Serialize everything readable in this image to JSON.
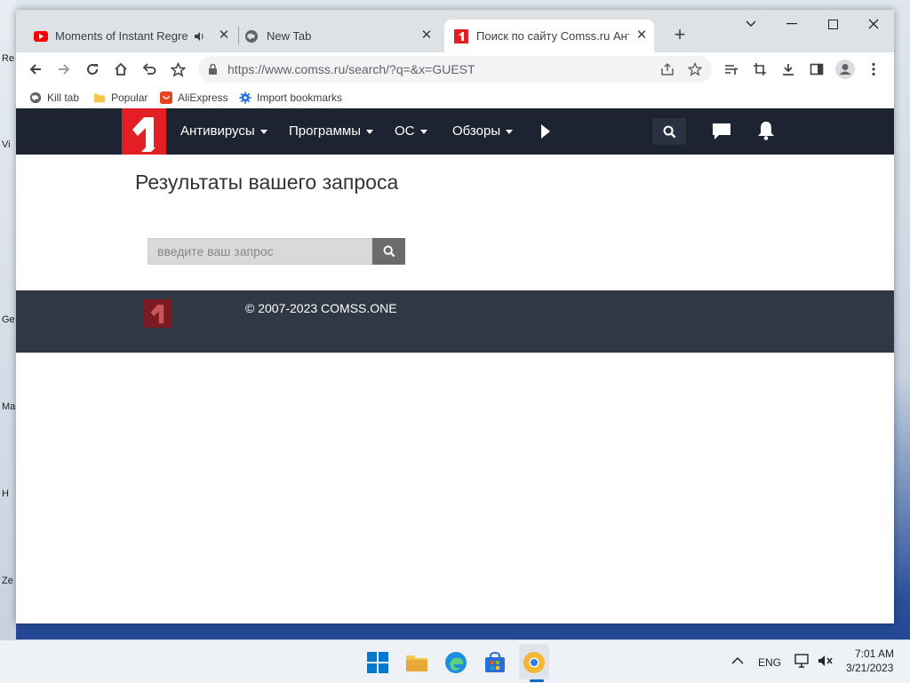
{
  "desktop": {
    "labels": [
      "Re",
      "Vi",
      "Ge",
      "Ma",
      "H",
      "Ze"
    ]
  },
  "browser": {
    "tabs": [
      {
        "title": "Moments of Instant Regret C",
        "icon": "youtube-icon",
        "audio": true
      },
      {
        "title": "New Tab",
        "icon": "globe-icon"
      },
      {
        "title": "Поиск по сайту Comss.ru Антив",
        "icon": "comss-icon",
        "active": true
      }
    ],
    "url": "https://www.comss.ru/search/?q=&x=GUEST",
    "bookmarks": [
      {
        "label": "Kill tab",
        "icon": "globe-icon"
      },
      {
        "label": "Popular",
        "icon": "folder-icon"
      },
      {
        "label": "AliExpress",
        "icon": "aliexpress-icon"
      },
      {
        "label": "Import bookmarks",
        "icon": "gear-icon"
      }
    ]
  },
  "site": {
    "nav": [
      {
        "label": "Антивирусы",
        "dropdown": true
      },
      {
        "label": "Программы",
        "dropdown": true
      },
      {
        "label": "ОС",
        "dropdown": true
      },
      {
        "label": "Обзоры",
        "dropdown": true
      }
    ],
    "results_title": "Результаты вашего запроса",
    "search_placeholder": "введите ваш запрос",
    "search_value": "",
    "copyright": "© 2007-2023 COMSS.ONE",
    "colors": {
      "brand": "#e31e24",
      "nav_bg": "#1d2330",
      "footer_bg": "#2f3844"
    }
  },
  "taskbar": {
    "lang": "ENG",
    "time": "7:01 AM",
    "date": "3/21/2023"
  }
}
